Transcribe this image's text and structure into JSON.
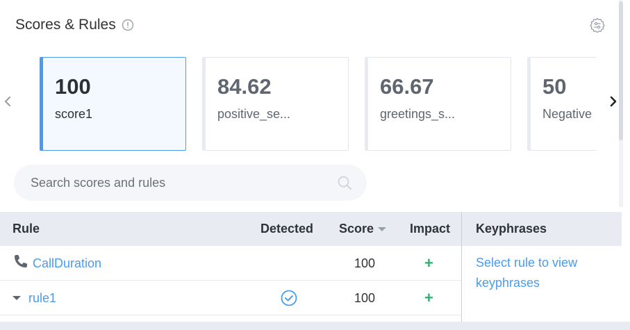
{
  "header": {
    "title": "Scores & Rules"
  },
  "cards": [
    {
      "value": "100",
      "label": "score1",
      "selected": true
    },
    {
      "value": "84.62",
      "label": "positive_se...",
      "selected": false
    },
    {
      "value": "66.67",
      "label": "greetings_s...",
      "selected": false
    },
    {
      "value": "50",
      "label": "Negative",
      "selected": false
    }
  ],
  "search": {
    "placeholder": "Search scores and rules"
  },
  "table": {
    "columns": {
      "rule": "Rule",
      "detected": "Detected",
      "score": "Score",
      "impact": "Impact"
    },
    "rows": [
      {
        "rule": "CallDuration",
        "icon": "phone-icon",
        "detected": false,
        "score": "100",
        "impact": "+"
      },
      {
        "rule": "rule1",
        "icon": "caret-down-icon",
        "detected": true,
        "score": "100",
        "impact": "+"
      }
    ]
  },
  "keyphrases": {
    "title": "Keyphrases",
    "message": "Select rule to view keyphrases"
  },
  "colors": {
    "accent": "#4a9bf0",
    "positive": "#2fb36e",
    "header_bg": "#e8ebf1"
  }
}
